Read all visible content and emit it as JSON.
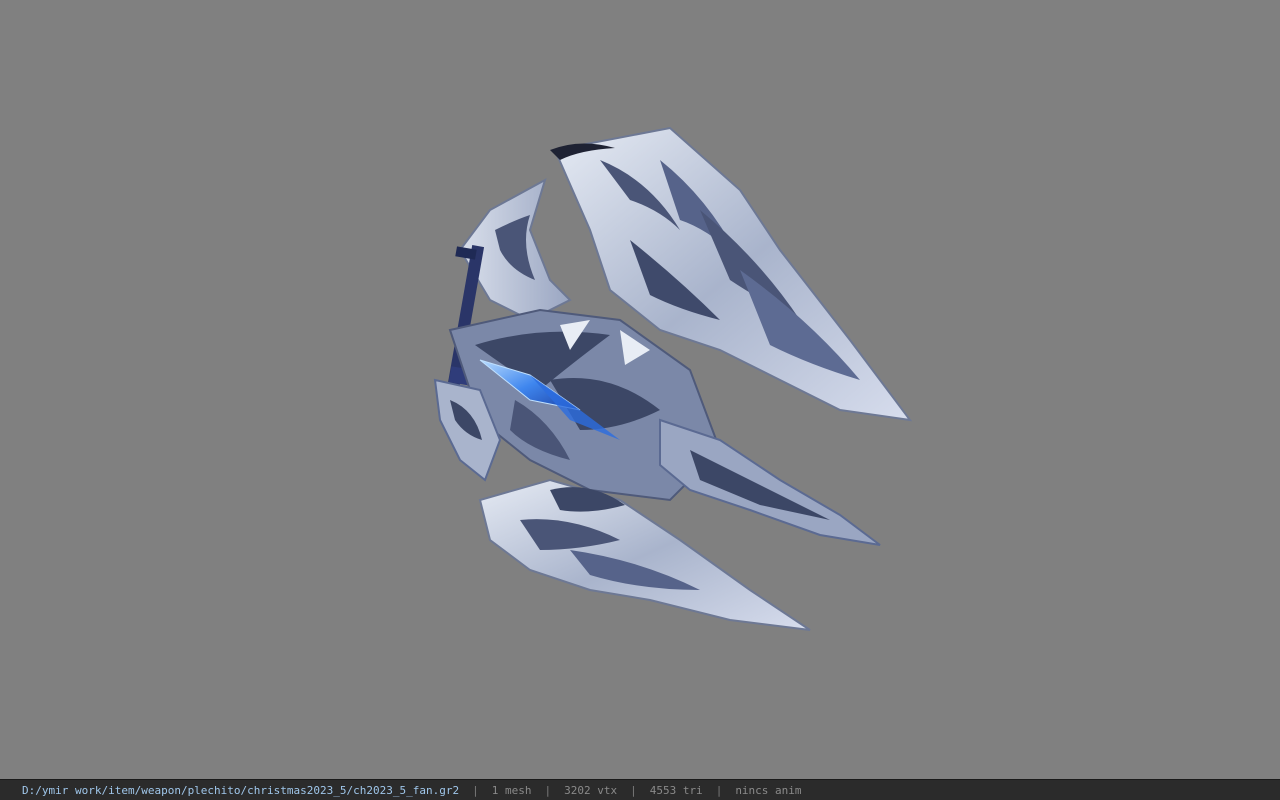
{
  "viewer": {
    "background_color": "#808080",
    "model": {
      "description_icon": "fan-weapon-model",
      "palette": [
        "#3c4766",
        "#5b6a92",
        "#c9d2e3",
        "#e8edf5",
        "#2c6de0"
      ]
    }
  },
  "status_bar": {
    "file_path": "D:/ymir work/item/weapon/plechito/christmas2023_5/ch2023_5_fan.gr2",
    "separator": "|",
    "mesh_count": "1 mesh",
    "vertex_count": "3202 vtx",
    "triangle_count": "4553 tri",
    "animation_status": "nincs anim"
  }
}
